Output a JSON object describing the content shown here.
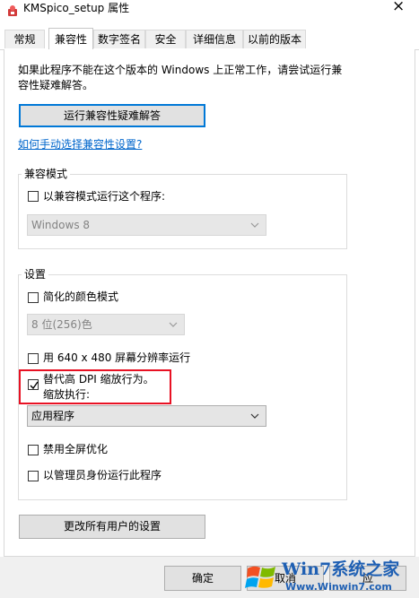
{
  "window": {
    "title": "KMSpico_setup 属性",
    "close_glyph": "×"
  },
  "tabs": [
    "常规",
    "兼容性",
    "数字签名",
    "安全",
    "详细信息",
    "以前的版本"
  ],
  "active_tab": "兼容性",
  "compat": {
    "intro_line1": "如果此程序不能在这个版本的 Windows 上正常工作，请尝试运行兼",
    "intro_line2": "容性疑难解答。",
    "troubleshooter_button": "运行兼容性疑难解答",
    "manual_link": "如何手动选择兼容性设置?",
    "mode_group": {
      "label": "兼容模式",
      "checkbox_label": "以兼容模式运行这个程序:",
      "checked": false,
      "os_value": "Windows 8"
    },
    "settings_group": {
      "label": "设置",
      "reduced_color": {
        "label": "简化的颜色模式",
        "checked": false
      },
      "color_value": "8 位(256)色",
      "res_640": {
        "label": "用 640 x 480 屏幕分辨率运行",
        "checked": false
      },
      "dpi_override": {
        "label_line1": "替代高 DPI 缩放行为。",
        "label_line2": "缩放执行:",
        "checked": true
      },
      "dpi_value": "应用程序",
      "disable_fullscreen": {
        "label": "禁用全屏优化",
        "checked": false
      },
      "run_as_admin": {
        "label": "以管理员身份运行此程序",
        "checked": false
      }
    },
    "all_users_button": "更改所有用户的设置"
  },
  "footer": {
    "ok": "确定",
    "cancel": "取消",
    "apply": "应"
  },
  "watermark": {
    "brand_top": "Win7系统之家",
    "url": "Www.Winwin7.com"
  },
  "colors": {
    "accent": "#0078d7",
    "highlight_box": "#e81123",
    "link": "#0066cc"
  }
}
